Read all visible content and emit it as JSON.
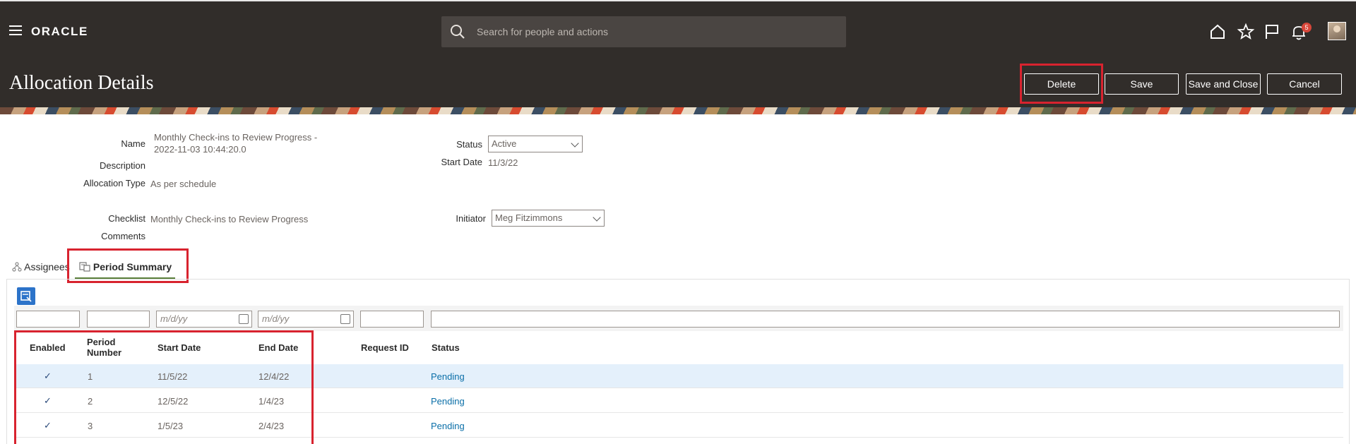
{
  "header": {
    "brand": "ORACLE",
    "search_placeholder": "Search for people and actions",
    "notification_count": "5"
  },
  "page": {
    "title": "Allocation Details",
    "buttons": {
      "delete": "Delete",
      "save": "Save",
      "save_close": "Save and Close",
      "cancel": "Cancel"
    }
  },
  "form": {
    "name_label": "Name",
    "name_value_line1": "Monthly Check-ins to Review Progress -",
    "name_value_line2": "2022-11-03 10:44:20.0",
    "description_label": "Description",
    "allocation_type_label": "Allocation Type",
    "allocation_type_value": "As per schedule",
    "status_label": "Status",
    "status_value": "Active",
    "start_date_label": "Start Date",
    "start_date_value": "11/3/22",
    "checklist_label": "Checklist",
    "checklist_value": "Monthly Check-ins to Review Progress",
    "comments_label": "Comments",
    "initiator_label": "Initiator",
    "initiator_value": "Meg Fitzimmons"
  },
  "tabs": {
    "assignees": "Assignees",
    "period_summary": "Period Summary"
  },
  "table": {
    "date_placeholder": "m/d/yy",
    "columns": {
      "enabled": "Enabled",
      "period_number_l1": "Period",
      "period_number_l2": "Number",
      "start_date": "Start Date",
      "end_date": "End Date",
      "request_id": "Request ID",
      "status": "Status"
    },
    "rows": [
      {
        "enabled": "✓",
        "period": "1",
        "start": "11/5/22",
        "end": "12/4/22",
        "status": "Pending"
      },
      {
        "enabled": "✓",
        "period": "2",
        "start": "12/5/22",
        "end": "1/4/23",
        "status": "Pending"
      },
      {
        "enabled": "✓",
        "period": "3",
        "start": "1/5/23",
        "end": "2/4/23",
        "status": "Pending"
      }
    ]
  },
  "colors": {
    "header_bg": "#312d2a",
    "highlight": "#d8232f",
    "link": "#0b6fa8",
    "selected_row": "#e4f0fb"
  }
}
